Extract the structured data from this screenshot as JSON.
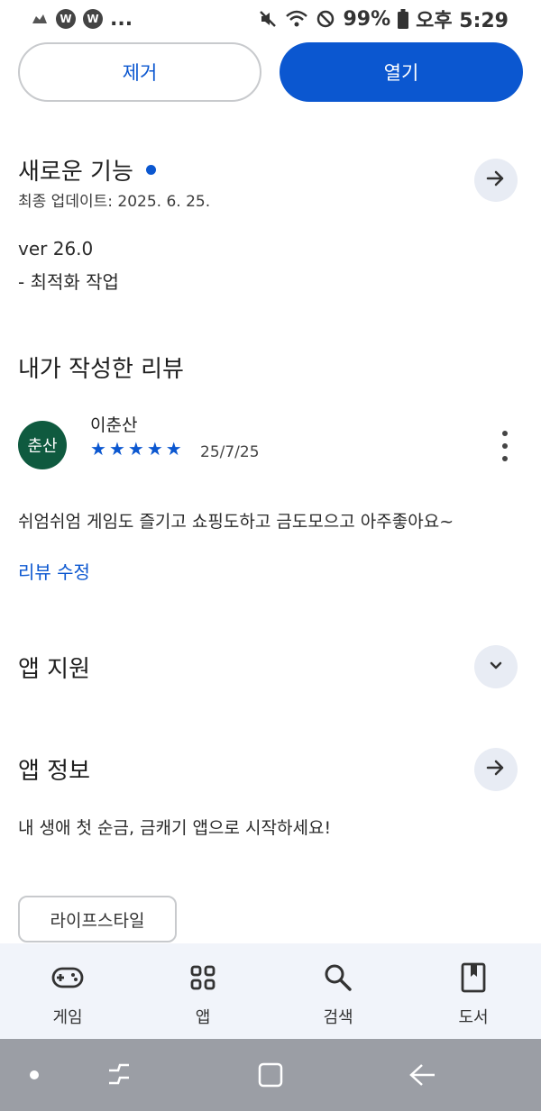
{
  "status_bar": {
    "left_ellipsis": "...",
    "battery": "99%",
    "time": "오후 5:29",
    "icons": [
      "cloud-icon",
      "coin-w-icon",
      "coin-w-icon",
      "mute-icon",
      "wifi-icon",
      "no-sign-icon",
      "battery-icon"
    ],
    "coin_letter": "W"
  },
  "actions": {
    "remove_label": "제거",
    "open_label": "열기"
  },
  "whats_new": {
    "title": "새로운 기능",
    "last_updated": "최종 업데이트: 2025. 6. 25.",
    "version": "ver 26.0",
    "notes": "- 최적화 작업"
  },
  "my_review": {
    "title": "내가 작성한 리뷰",
    "avatar_text": "춘산",
    "reviewer_name": "이춘산",
    "rating": 5,
    "stars": [
      "★",
      "★",
      "★",
      "★",
      "★"
    ],
    "date": "25/7/25",
    "text": "쉬엄쉬엄 게임도 즐기고 쇼핑도하고 금도모으고 아주좋아요~",
    "edit_label": "리뷰 수정"
  },
  "app_support": {
    "title": "앱 지원"
  },
  "app_info": {
    "title": "앱 정보",
    "description": "내 생애 첫 순금, 금캐기 앱으로 시작하세요!",
    "category_chip": "라이프스타일"
  },
  "bottom_nav": {
    "items": [
      {
        "label": "게임",
        "icon": "gamepad-icon"
      },
      {
        "label": "앱",
        "icon": "apps-grid-icon"
      },
      {
        "label": "검색",
        "icon": "search-icon"
      },
      {
        "label": "도서",
        "icon": "book-icon"
      }
    ]
  },
  "colors": {
    "accent": "#0b57d0",
    "avatar_bg": "#0f5a3f",
    "nav_bg": "#f1f4fa",
    "system_nav_bg": "#9b9ea5"
  }
}
